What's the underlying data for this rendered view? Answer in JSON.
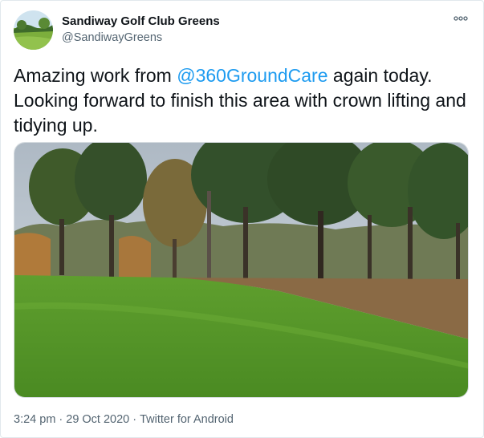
{
  "user": {
    "display_name": "Sandiway Golf Club Greens",
    "handle": "@SandiwayGreens",
    "avatar_icon": "golf-course-avatar"
  },
  "tweet": {
    "text_before": "Amazing work from ",
    "mention": "@360GroundCare",
    "text_after": " again today. Looking forward to finish this area with crown lifting and tidying up."
  },
  "media": {
    "icon": "photo-golf-course-trees"
  },
  "meta": {
    "time": "3:24 pm",
    "date": "29 Oct 2020",
    "separator": "·",
    "source": "Twitter for Android"
  },
  "more_icon": "more-options-icon",
  "colors": {
    "link": "#1d9bf0",
    "secondary_text": "#536471",
    "border": "#e1e8ed"
  }
}
